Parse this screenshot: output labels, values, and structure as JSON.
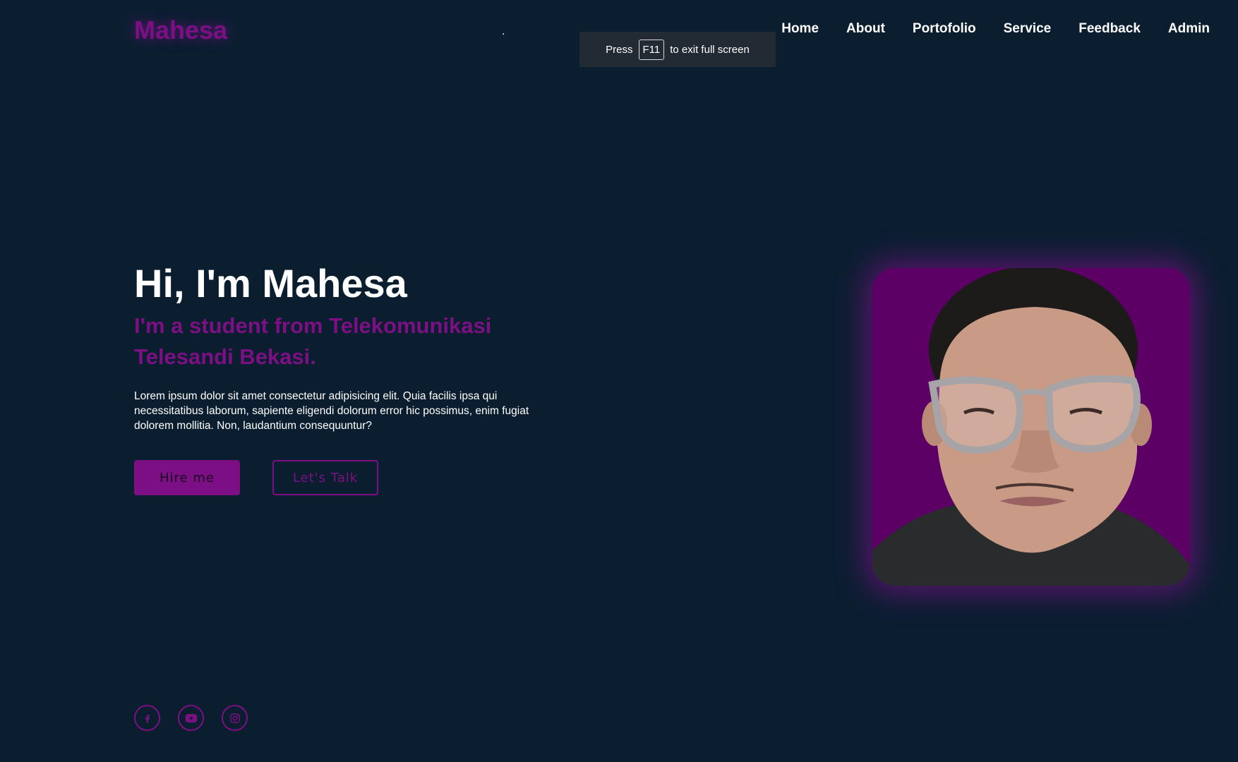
{
  "header": {
    "logo": "Mahesa",
    "dot": ".",
    "nav": [
      "Home",
      "About",
      "Portofolio",
      "Service",
      "Feedback",
      "Admin"
    ]
  },
  "fullscreen_notice": {
    "prefix": "Press",
    "key": "F11",
    "suffix": "to exit full screen"
  },
  "hero": {
    "title": "Hi, I'm Mahesa",
    "subtitle": "I'm a student from Telekomunikasi Telesandi Bekasi.",
    "description": "Lorem ipsum dolor sit amet consectetur adipisicing elit. Quia facilis ipsa qui necessitatibus laborum, sapiente eligendi dolorum error hic possimus, enim fugiat dolorem mollitia. Non, laudantium consequuntur?",
    "hire_label": "Hire me",
    "talk_label": "Let's Talk"
  },
  "social": [
    "facebook-icon",
    "youtube-icon",
    "instagram-icon"
  ],
  "colors": {
    "background": "#0b1e30",
    "accent": "#7d0f84",
    "photo_bg": "#5c0065"
  }
}
